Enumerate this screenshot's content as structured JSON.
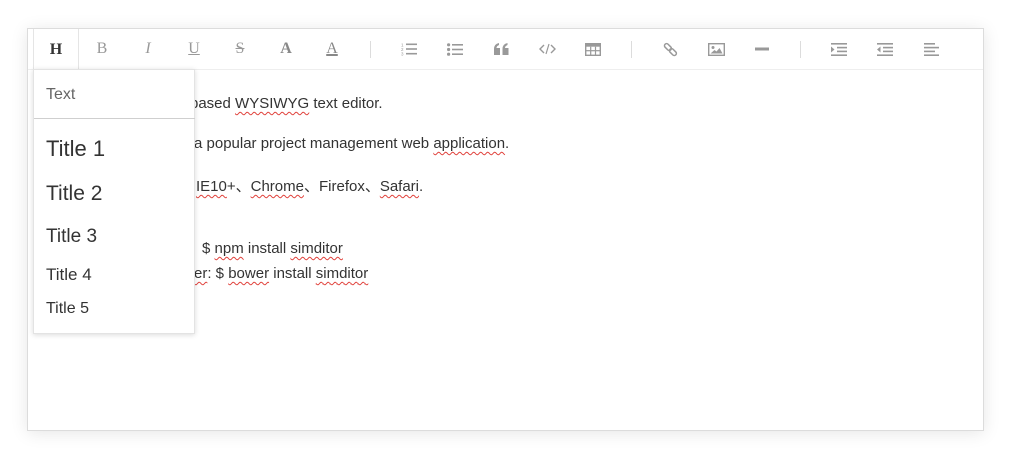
{
  "toolbar": {
    "title_button": "H",
    "bold_button": "B",
    "italic_button": "I",
    "underline_button": "U",
    "strikethrough_button": "S",
    "font_color_button": "A",
    "bg_color_button": "A"
  },
  "icons": [
    "title-icon",
    "bold-icon",
    "italic-icon",
    "underline-icon",
    "strikethrough-icon",
    "font-color-icon",
    "background-color-icon",
    "ordered-list-icon",
    "unordered-list-icon",
    "blockquote-icon",
    "code-icon",
    "table-icon",
    "link-icon",
    "image-icon",
    "horizontal-rule-icon",
    "indent-icon",
    "outdent-icon",
    "align-left-icon"
  ],
  "dropdown": {
    "text": "Text",
    "title1": "Title 1",
    "title2": "Title 2",
    "title3": "Title 3",
    "title4": "Title 4",
    "title5": "Title 5"
  },
  "content": {
    "line1": {
      "pre": "-based ",
      "word1": "WYSIWYG",
      "post": " text editor."
    },
    "line2": {
      "pre": "a popular project management web ",
      "word1": "application",
      "post": "."
    },
    "line3": {
      "w1": "IE10",
      "t1": "+、",
      "w2": "Chrome",
      "t2": "、Firefox、",
      "w3": "Safari",
      "t3": "."
    },
    "line4": {
      "t1": "$ ",
      "w1": "npm",
      "t2": " install ",
      "w2": "simditor"
    },
    "line5": {
      "w0": "er",
      "t0": ": $ ",
      "w1": "bower",
      "t1": " install ",
      "w2": "simditor"
    }
  },
  "colors": {
    "border": "#dcdcdc",
    "icon": "#999999",
    "text": "#333333",
    "spellcheck": "#e0403a"
  }
}
